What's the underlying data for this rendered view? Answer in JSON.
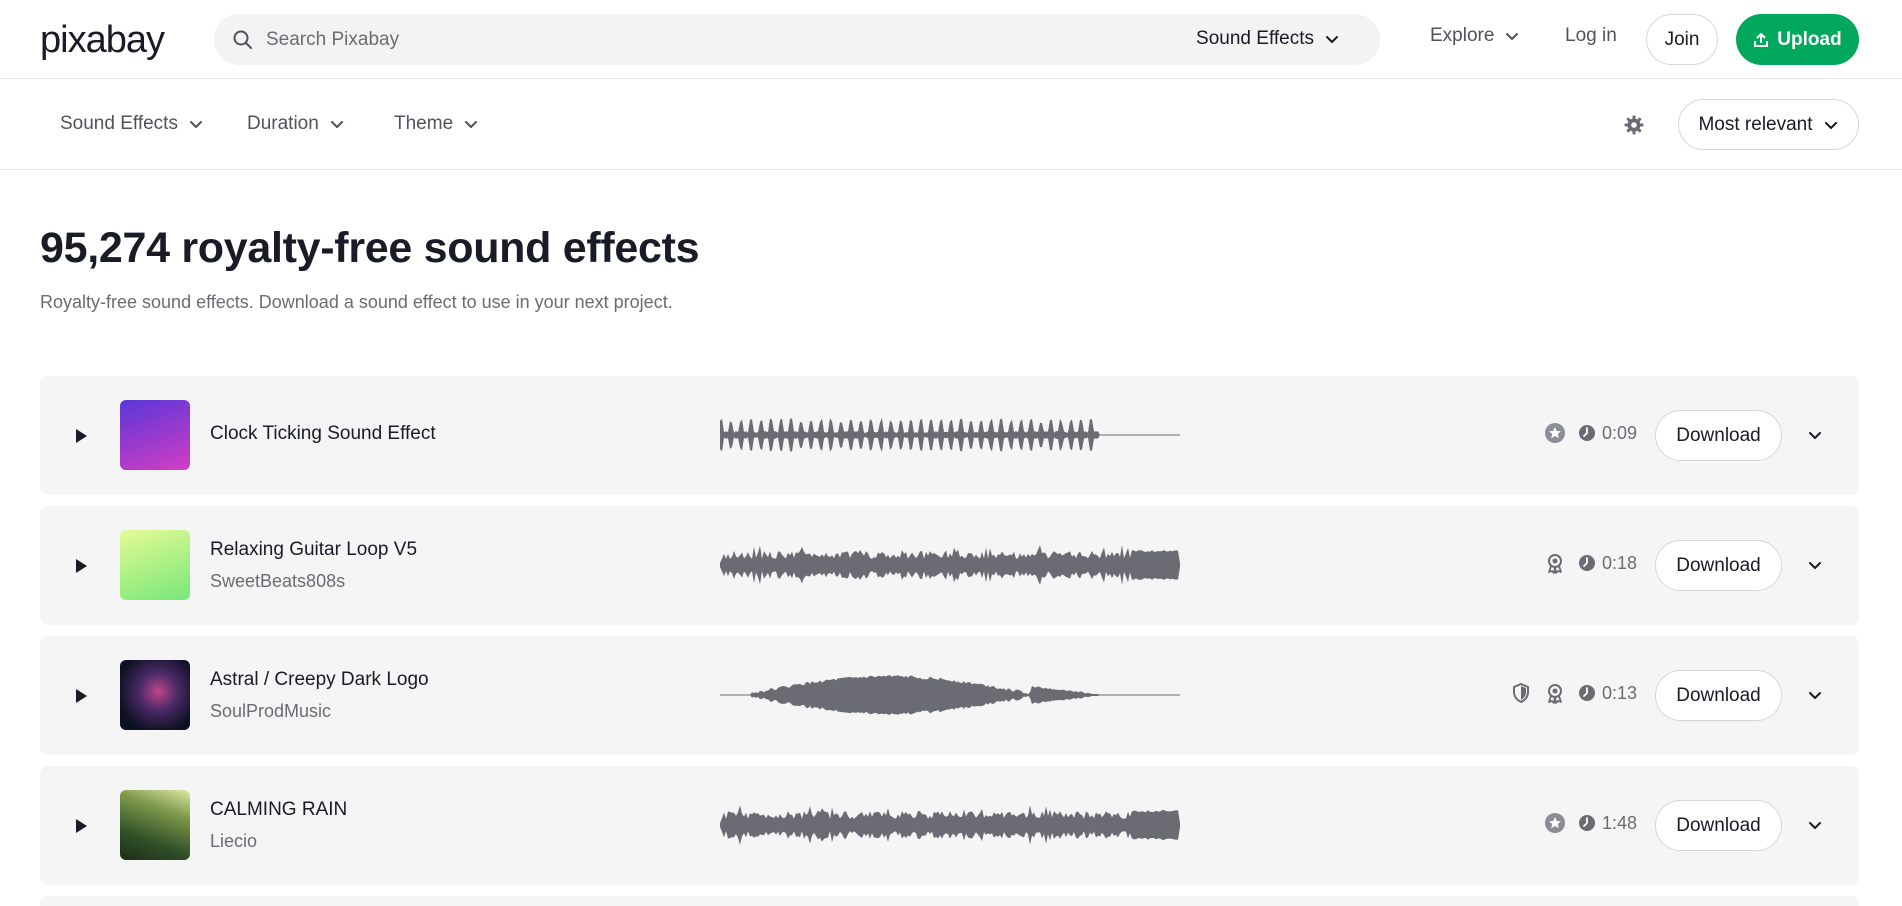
{
  "header": {
    "logo_text": "pixabay",
    "search": {
      "placeholder": "Search Pixabay",
      "category": "Sound Effects"
    },
    "nav": {
      "explore": "Explore",
      "login": "Log in",
      "join": "Join",
      "upload": "Upload"
    },
    "colors": {
      "accent": "#02a95c"
    }
  },
  "filters": {
    "items": [
      "Sound Effects",
      "Duration",
      "Theme"
    ],
    "sort": "Most relevant"
  },
  "main": {
    "title": "95,274 royalty-free sound effects",
    "subtitle": "Royalty-free sound effects. Download a sound effect to use in your next project."
  },
  "tracks": [
    {
      "title": "Clock Ticking Sound Effect",
      "author": "",
      "duration": "0:09",
      "download_label": "Download",
      "badges": [
        "star-badge-icon"
      ],
      "thumb_colors": [
        "#5a36d8",
        "#d23ec4"
      ],
      "waveform_style": "ticks"
    },
    {
      "title": "Relaxing Guitar Loop V5",
      "author": "SweetBeats808s",
      "duration": "0:18",
      "download_label": "Download",
      "badges": [
        "award-icon"
      ],
      "thumb_colors": [
        "#e4fb93",
        "#77e77a"
      ],
      "waveform_style": "dense"
    },
    {
      "title": "Astral / Creepy Dark Logo",
      "author": "SoulProdMusic",
      "duration": "0:13",
      "download_label": "Download",
      "badges": [
        "shield-icon",
        "award-icon"
      ],
      "thumb_colors": [
        "#0e1124",
        "#4a2a66"
      ],
      "waveform_style": "swell"
    },
    {
      "title": "CALMING RAIN",
      "author": "Liecio",
      "duration": "1:48",
      "download_label": "Download",
      "badges": [
        "star-badge-icon"
      ],
      "thumb_colors": [
        "#2f4f28",
        "#b9c97a"
      ],
      "waveform_style": "dense"
    }
  ]
}
